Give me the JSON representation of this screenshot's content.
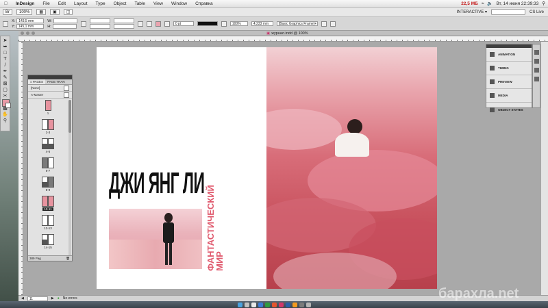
{
  "menubar": {
    "app_name": "InDesign",
    "menus": [
      "File",
      "Edit",
      "Layout",
      "Type",
      "Object",
      "Table",
      "View",
      "Window",
      "Справка"
    ],
    "cpu": "22,5 МБ",
    "clock": "Вт, 14 июня 22:39:33"
  },
  "appbar": {
    "zoom": "100%",
    "workspace": "INTERACTIVE ▾",
    "cs_live": "CS Live"
  },
  "controlbar": {
    "x_value": "143,5 mm",
    "y_value": "145,1 mm",
    "stroke_weight": "0 pt",
    "opacity": "100%",
    "size_value": "4,233 mm",
    "frame_style": "[Basic Graphics Frame]+"
  },
  "document": {
    "tab_title": "журнал.indd @ 100%",
    "headline": "ДЖИ ЯНГ ЛИ",
    "vertical_text_line1": "ФАНТАСТИЧЕСКИЙ",
    "vertical_text_line2": "МИР"
  },
  "pages_panel": {
    "tabs": [
      "≡ PAGES",
      "PAGE TRAN"
    ],
    "masters": [
      "[None]",
      "A-Master"
    ],
    "pages": [
      "1",
      "2-3",
      "4-5",
      "6-7",
      "8-9",
      "10-11",
      "12-13",
      "14-15"
    ],
    "footer": "389 Pag"
  },
  "right_panel": {
    "items": [
      "ANIMATION",
      "TIMING",
      "PREVIEW",
      "MEDIA",
      "OBJECT STATES"
    ]
  },
  "statusbar": {
    "page": "11",
    "errors": "No errors"
  },
  "watermark": "барахла.net",
  "colors": {
    "accent_pink": "#e05a6e",
    "swatch_fill": "#e79aa6"
  }
}
